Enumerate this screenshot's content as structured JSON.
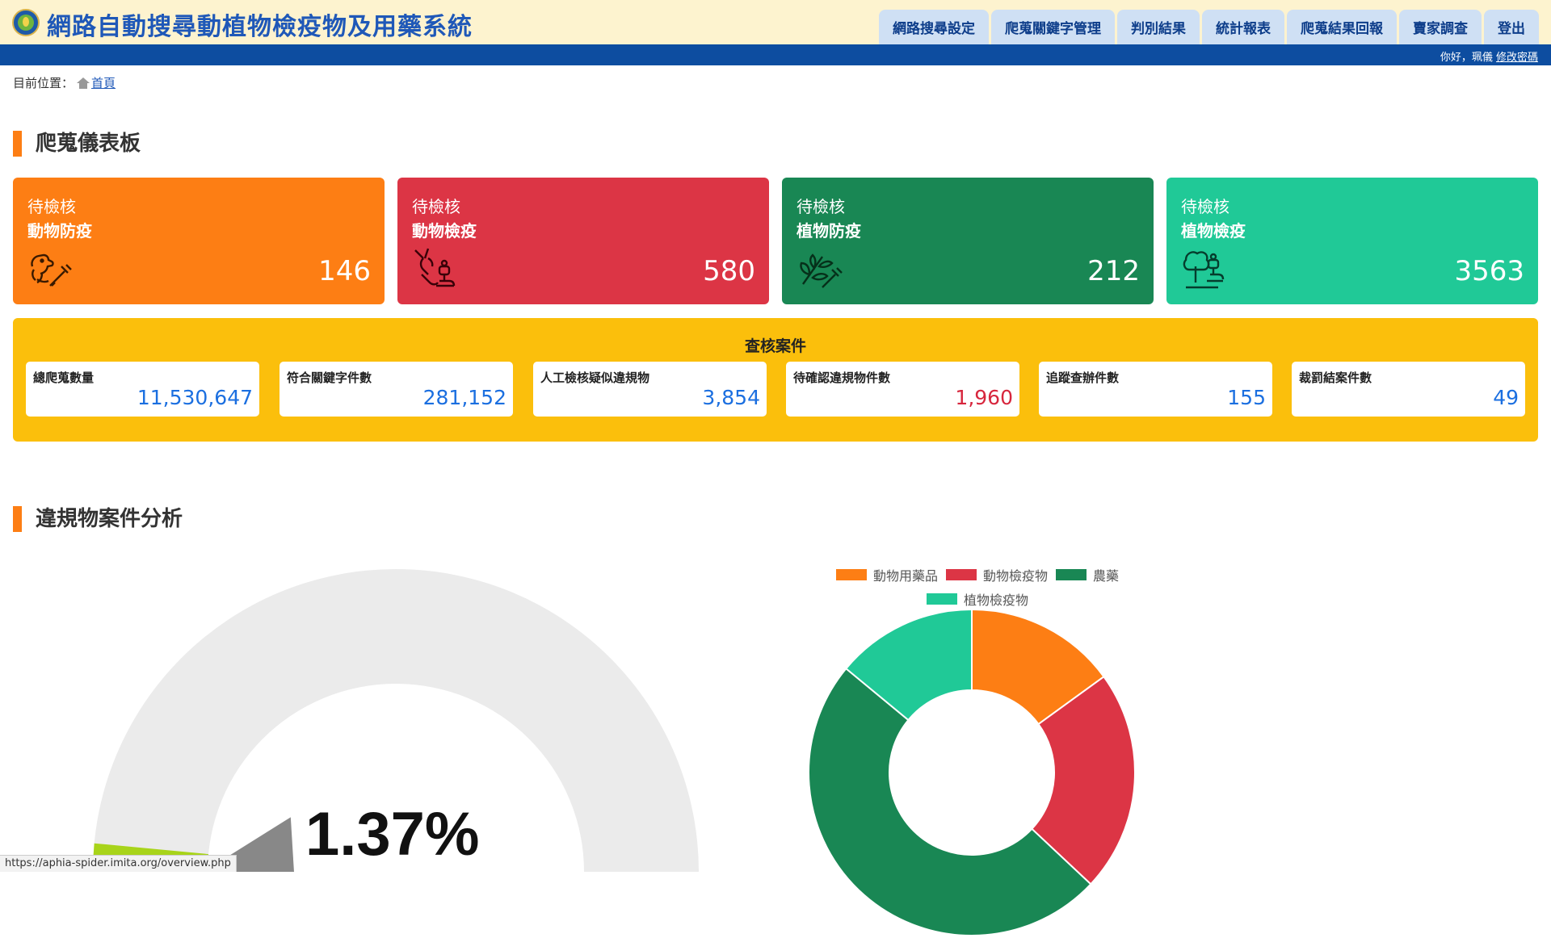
{
  "header": {
    "title": "網路自動搜尋動植物檢疫物及用藥系統",
    "nav": [
      "網路搜尋設定",
      "爬蒐關鍵字管理",
      "判別結果",
      "統計報表",
      "爬蒐結果回報",
      "賣家調查",
      "登出"
    ],
    "greeting": "你好，珮儀",
    "change_password": "修改密碼"
  },
  "breadcrumb": {
    "label": "目前位置：",
    "home": "首頁"
  },
  "dashboard": {
    "heading": "爬蒐儀表板",
    "cards": [
      {
        "pre": "待檢核",
        "name": "動物防疫",
        "value": "146",
        "color": "#fd7e14",
        "icon": "dog-syringe-icon"
      },
      {
        "pre": "待檢核",
        "name": "動物檢疫",
        "value": "580",
        "color": "#dc3545",
        "icon": "goat-microscope-icon"
      },
      {
        "pre": "待檢核",
        "name": "植物防疫",
        "value": "212",
        "color": "#198754",
        "icon": "leaf-syringe-icon"
      },
      {
        "pre": "待檢核",
        "name": "植物檢疫",
        "value": "3563",
        "color": "#20c997",
        "icon": "tree-microscope-icon"
      }
    ]
  },
  "cases": {
    "title": "查核案件",
    "items": [
      {
        "label": "總爬蒐數量",
        "value": "11,530,647"
      },
      {
        "label": "符合關鍵字件數",
        "value": "281,152"
      },
      {
        "label": "人工檢核疑似違規物",
        "value": "3,854"
      },
      {
        "label": "待確認違規物件數",
        "value": "1,960"
      },
      {
        "label": "追蹤查辦件數",
        "value": "155"
      },
      {
        "label": "裁罰結案件數",
        "value": "49"
      }
    ]
  },
  "analysis": {
    "heading": "違規物案件分析",
    "gauge_value": "1.37%",
    "gauge_fraction": 0.0137
  },
  "chart_data": {
    "type": "pie",
    "labels": [
      "動物用藥品",
      "動物檢疫物",
      "農藥",
      "植物檢疫物"
    ],
    "values": [
      15,
      22,
      49,
      14
    ],
    "colors": [
      "#fd7e14",
      "#dc3545",
      "#198754",
      "#20c997"
    ],
    "legend": "top"
  },
  "status_url": "https://aphia-spider.imita.org/overview.php"
}
